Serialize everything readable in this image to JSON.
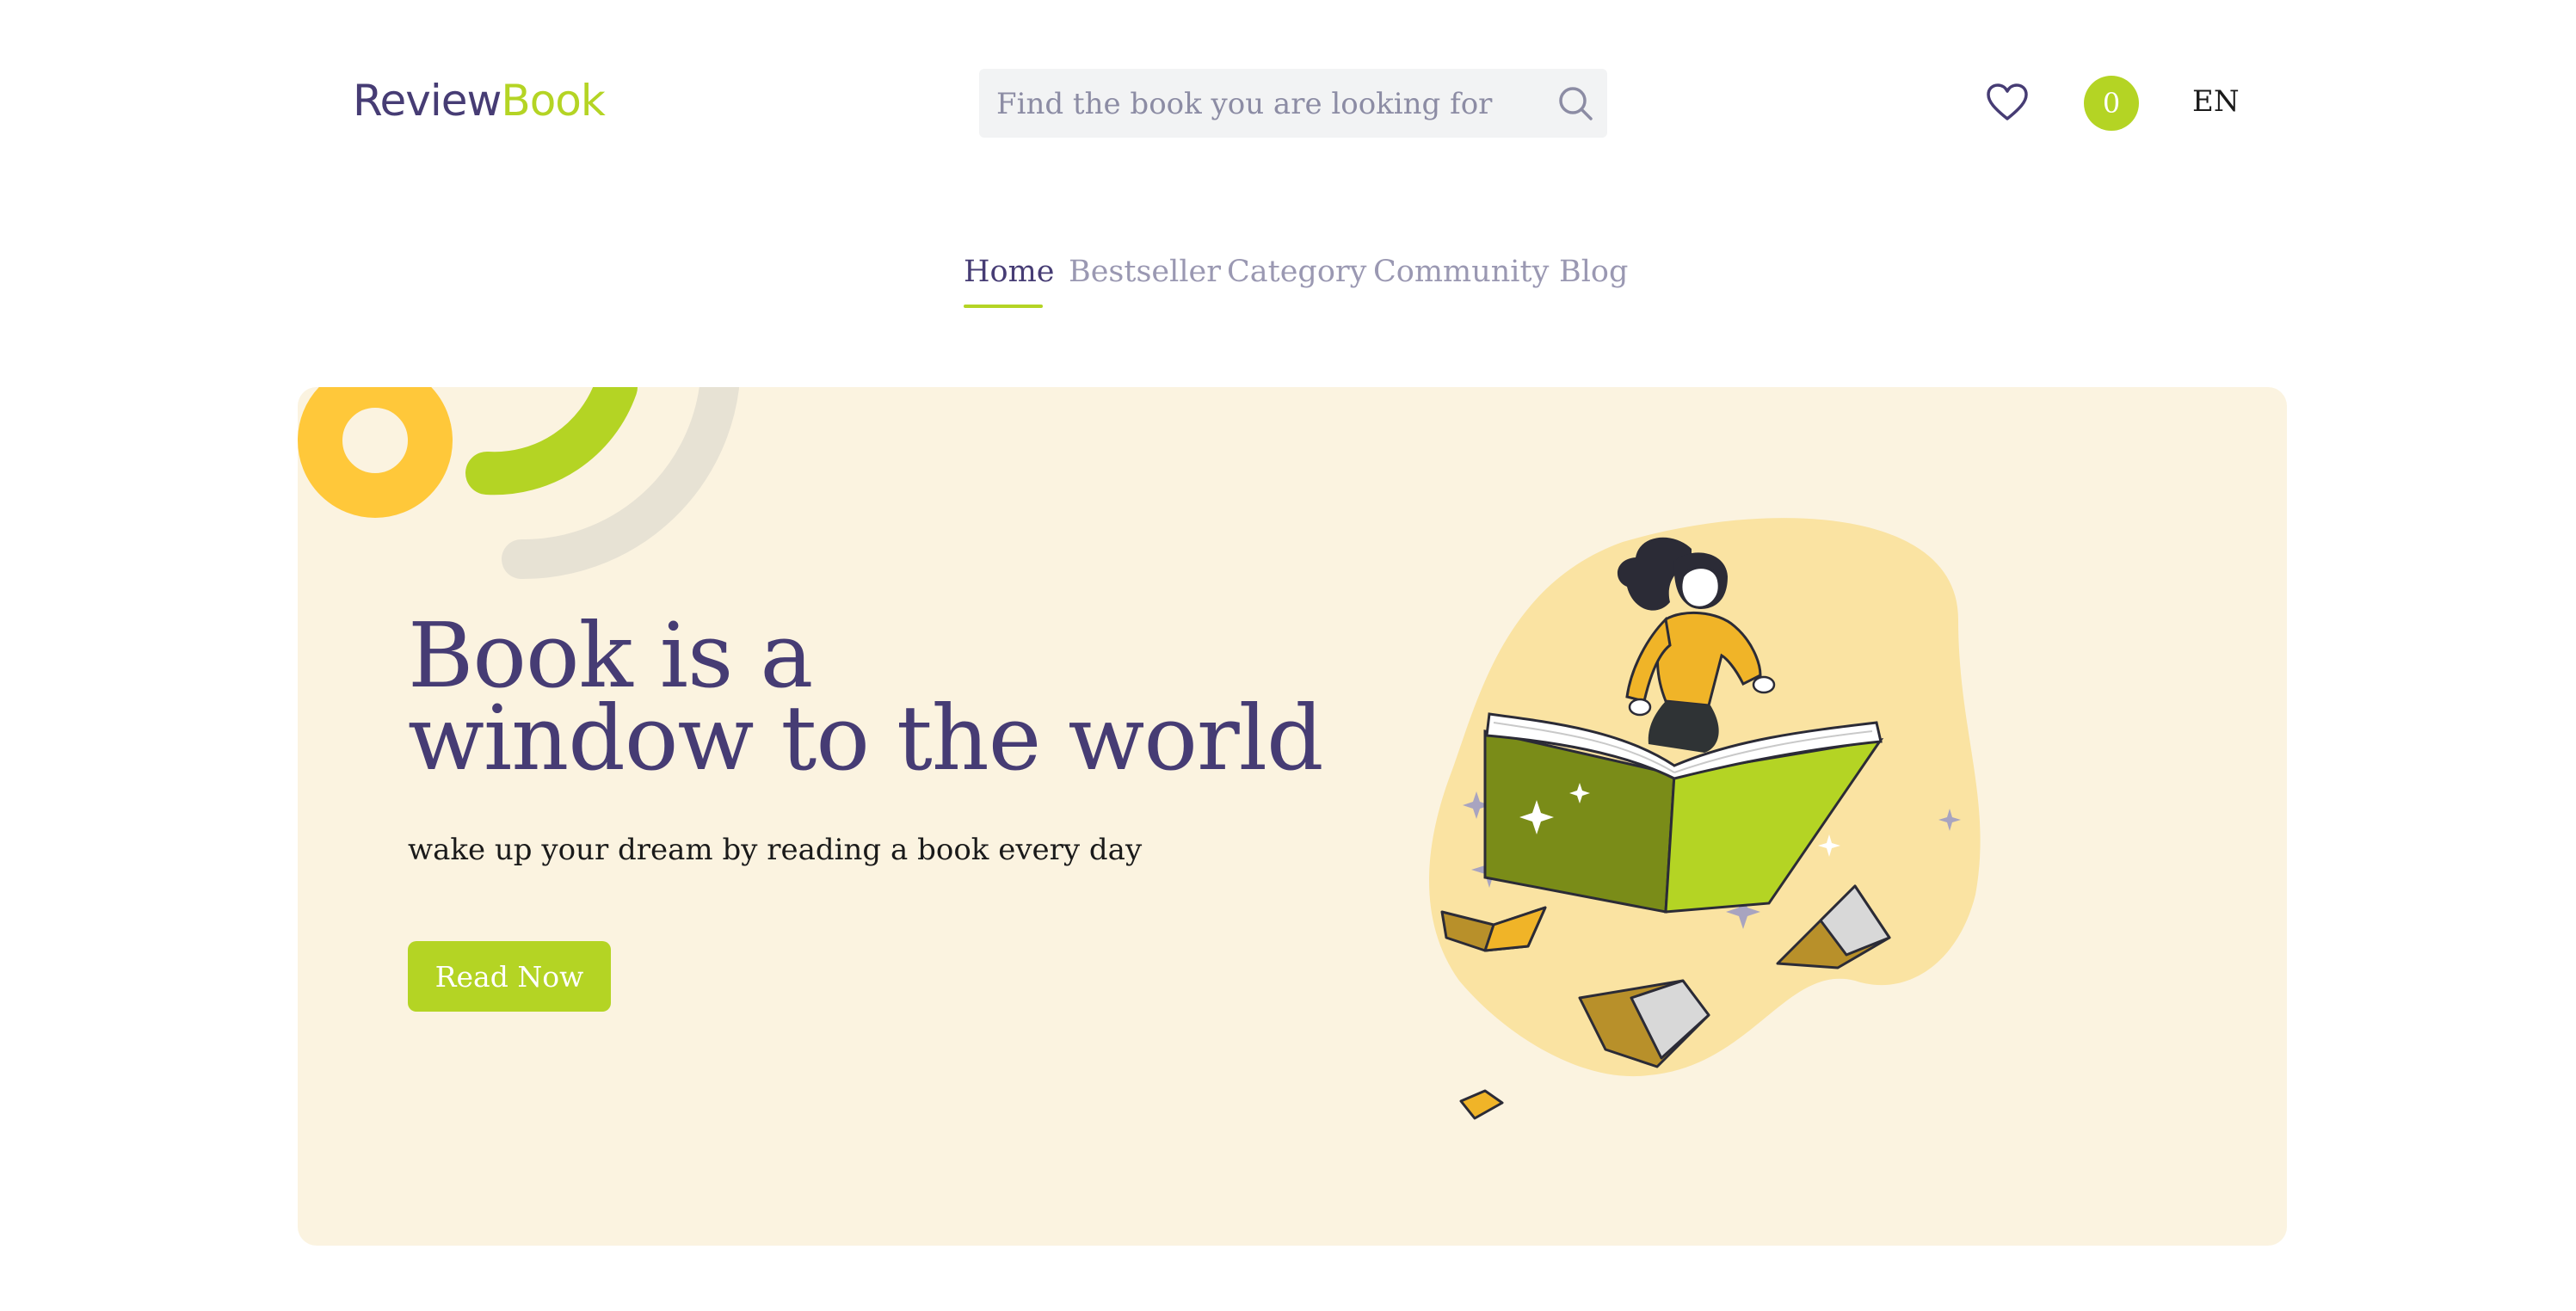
{
  "header": {
    "logo_part1": "Review",
    "logo_part2": "Book",
    "search_placeholder": "Find the book you are looking for",
    "cart_count": "0",
    "language": "EN"
  },
  "nav": {
    "items": [
      "Home",
      "Bestseller",
      "Category",
      "Community",
      "Blog"
    ],
    "active": "Home"
  },
  "hero": {
    "title_line1": "Book is a",
    "title_line2": "window to the world",
    "subtitle": "wake up your dream by reading a book every day",
    "cta_label": "Read Now"
  },
  "colors": {
    "primary": "#463c74",
    "accent": "#b4d424",
    "hero_bg": "#fbf3e0",
    "yellow": "#ffc83a"
  },
  "icons": [
    "search-icon",
    "heart-icon"
  ]
}
